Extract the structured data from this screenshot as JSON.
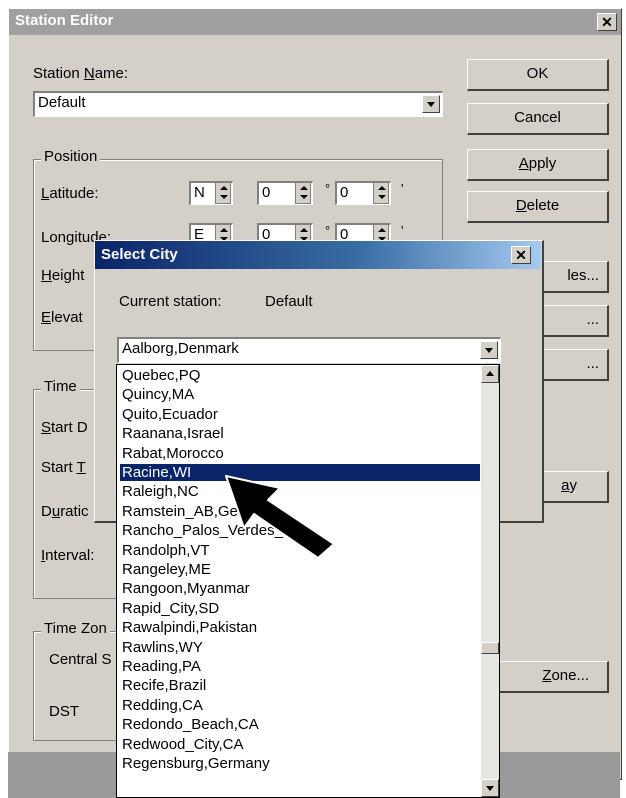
{
  "station_editor": {
    "title": "Station Editor",
    "close_glyph": "✕",
    "station_name_label_pre": "Station ",
    "station_name_label_ul": "N",
    "station_name_label_post": "ame:",
    "station_name_value": "Default",
    "buttons": {
      "ok": "OK",
      "cancel": "Cancel",
      "apply_ul": "A",
      "apply_rest": "pply",
      "delete_ul": "D",
      "delete_rest": "elete",
      "partial_1": "les...",
      "partial_2": "...",
      "partial_3": "...",
      "partial_4_ul": "a",
      "partial_4_rest": "y",
      "zone_ul": "Z",
      "zone_rest": "one..."
    },
    "position": {
      "legend": "Position",
      "latitude_ul": "L",
      "latitude_rest": "atitude:",
      "latitude_hemisphere": "N",
      "latitude_deg": "0",
      "latitude_min": "0",
      "longitude_label": "Longitude:",
      "longitude_hemisphere": "E",
      "longitude_deg": "0",
      "longitude_min": "0",
      "height_ul": "H",
      "height_rest": "eight",
      "elevation_ul": "E",
      "elevation_rest": "levat",
      "degree_symbol": "°",
      "minute_symbol": "'"
    },
    "time": {
      "legend": "Time",
      "start_date_ul": "S",
      "start_date_rest": "tart D",
      "start_time_pre": "Start ",
      "start_time_ul": "T",
      "duration_pre": "D",
      "duration_ul": "u",
      "duration_rest": "ratic",
      "interval_ul": "I",
      "interval_rest": "nterval:"
    },
    "time_zone": {
      "legend": "Time Zon",
      "central_label": "Central S",
      "dst_label": "DST"
    }
  },
  "select_city": {
    "title": "Select City",
    "close_glyph": "✕",
    "current_station_label": "Current station:",
    "current_station_value": "Default",
    "combo_value": "Aalborg,Denmark",
    "cities": [
      "Quebec,PQ",
      "Quincy,MA",
      "Quito,Ecuador",
      "Raanana,Israel",
      "Rabat,Morocco",
      "Racine,WI",
      "Raleigh,NC",
      "Ramstein_AB,Germ",
      "Rancho_Palos_Verdes_CA",
      "Randolph,VT",
      "Rangeley,ME",
      "Rangoon,Myanmar",
      "Rapid_City,SD",
      "Rawalpindi,Pakistan",
      "Rawlins,WY",
      "Reading,PA",
      "Recife,Brazil",
      "Redding,CA",
      "Redondo_Beach,CA",
      "Redwood_City,CA",
      "Regensburg,Germany"
    ],
    "selected_city": "Racine,WI"
  },
  "colors": {
    "selection": "#0a246a",
    "dialog_face": "#d4d0c8",
    "inactive_title": "#a0a0a0"
  },
  "icons": {
    "pointer": "black-arrow-icon"
  }
}
